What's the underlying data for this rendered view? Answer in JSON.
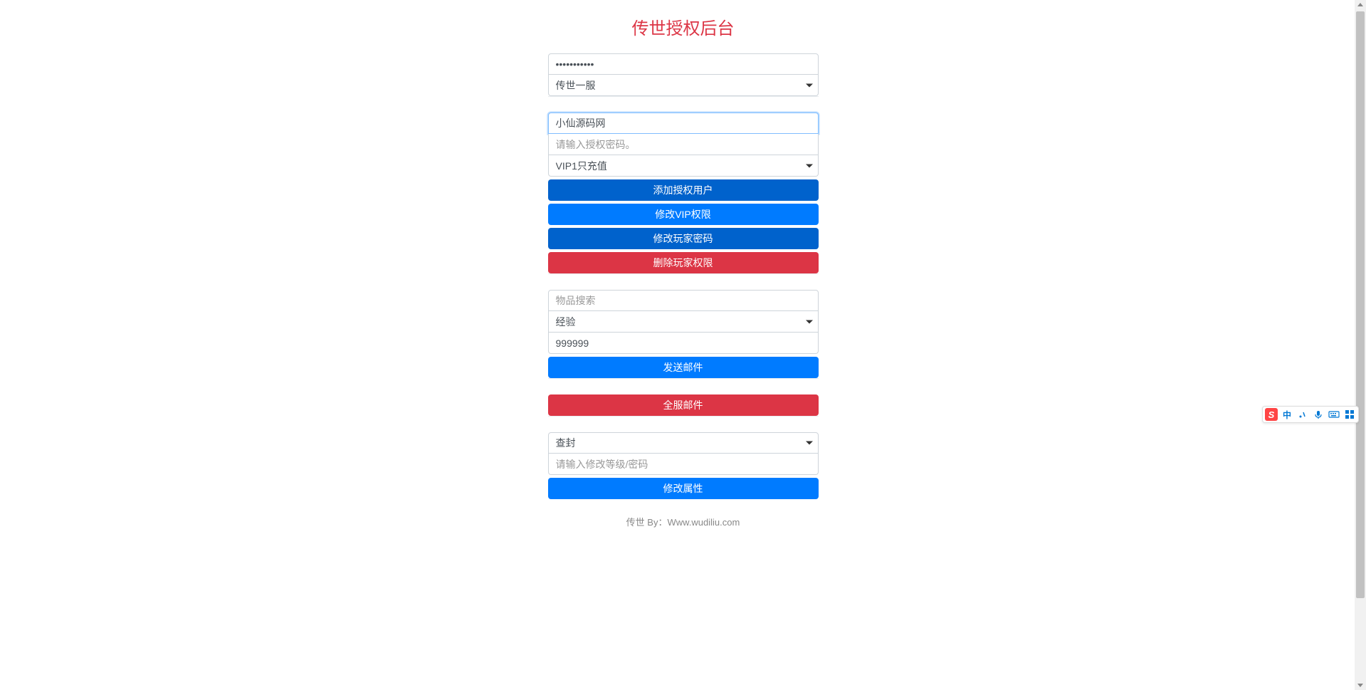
{
  "page_title": "传世授权后台",
  "section_auth": {
    "password_value": "•••••••••••",
    "server_select": "传世一服"
  },
  "section_user": {
    "username_value": "小仙源码网",
    "auth_password_placeholder": "请输入授权密码。",
    "vip_select": "VIP1只充值",
    "btn_add_user": "添加授权用户",
    "btn_modify_vip": "修改VIP权限",
    "btn_modify_password": "修改玩家密码",
    "btn_delete_permission": "删除玩家权限"
  },
  "section_item": {
    "item_search_placeholder": "物品搜索",
    "item_type_select": "经验",
    "quantity_value": "999999",
    "btn_send_mail": "发送邮件"
  },
  "section_server_mail": {
    "btn_server_mail": "全服邮件"
  },
  "section_modify": {
    "action_select": "查封",
    "level_password_placeholder": "请输入修改等级/密码",
    "btn_modify_attr": "修改属性"
  },
  "footer": "传世 By：Www.wudiliu.com",
  "ime": {
    "lang": "中"
  }
}
